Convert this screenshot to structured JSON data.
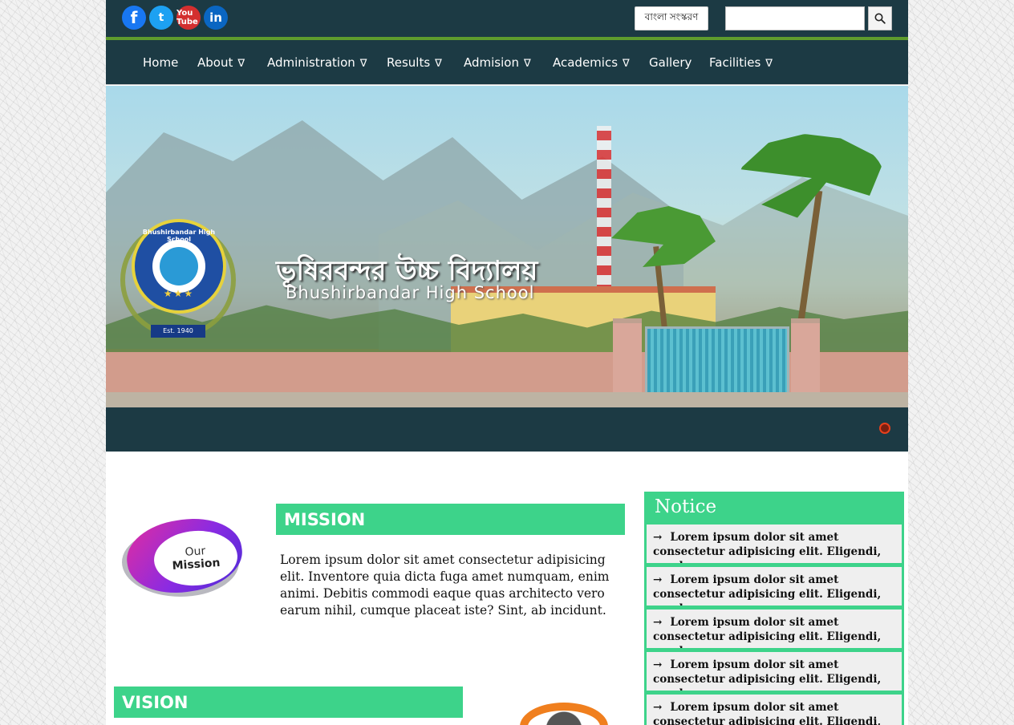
{
  "header": {
    "social": [
      {
        "name": "facebook-icon",
        "glyph": "f"
      },
      {
        "name": "twitter-icon",
        "glyph": "t"
      },
      {
        "name": "youtube-icon",
        "glyph": "You Tube"
      },
      {
        "name": "linkedin-icon",
        "glyph": "in"
      }
    ],
    "bangla_label": "বাংলা সংস্করণ",
    "search_value": "",
    "search_icon": "search-icon"
  },
  "nav": {
    "items": [
      {
        "label": "Home",
        "dropdown": false
      },
      {
        "label": "About",
        "dropdown": true
      },
      {
        "label": "Administration",
        "dropdown": true
      },
      {
        "label": "Results",
        "dropdown": true
      },
      {
        "label": "Admision",
        "dropdown": true
      },
      {
        "label": "Academics",
        "dropdown": true
      },
      {
        "label": "Gallery",
        "dropdown": false
      },
      {
        "label": "Facilities",
        "dropdown": true
      }
    ],
    "dropdown_glyph": "∇"
  },
  "banner": {
    "title_bn": "ভূষিরবন্দর উচ্চ বিদ্যালয়",
    "title_en": "Bhushirbandar High School",
    "logo_ring_text": "Bhushirbandar High School",
    "logo_est": "Est. 1940",
    "logo_stars": "★★★"
  },
  "mission": {
    "heading": "MISSION",
    "badge_line1": "Our",
    "badge_line2": "Mission",
    "text": "Lorem ipsum dolor sit amet consectetur adipisicing elit. Inventore quia dicta fuga amet numquam, enim animi. Debitis commodi eaque quas architecto vero earum nihil, cumque placeat iste? Sint, ab incidunt."
  },
  "vision": {
    "heading": "VISION"
  },
  "notice": {
    "title": "Notice",
    "items": [
      "Lorem ipsum dolor sit amet consectetur adipisicing elit. Eligendi, quod.",
      "Lorem ipsum dolor sit amet consectetur adipisicing elit. Eligendi, quod.",
      "Lorem ipsum dolor sit amet consectetur adipisicing elit. Eligendi, quod.",
      "Lorem ipsum dolor sit amet consectetur adipisicing elit. Eligendi, quod.",
      "Lorem ipsum dolor sit amet consectetur adipisicing elit. Eligendi, quod."
    ]
  },
  "colors": {
    "navbar": "#1c3a44",
    "accent_green": "#3dd38a",
    "topbar_border": "#5e9c2d",
    "slider_dot": "#e8401c"
  }
}
